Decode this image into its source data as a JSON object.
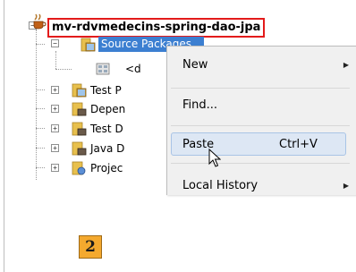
{
  "tree": {
    "project": "mv-rdvmedecins-spring-dao-jpa",
    "source_packages": "Source Packages",
    "default_package": "<d",
    "nodes": [
      "Test P",
      "Depen",
      "Test D",
      "Java D",
      "Projec"
    ]
  },
  "context_menu": {
    "items": [
      {
        "label": "New",
        "submenu": true
      },
      {
        "label": "Find...",
        "submenu": false
      },
      {
        "label": "Paste",
        "shortcut": "Ctrl+V",
        "submenu": false
      },
      {
        "label": "Local History",
        "submenu": true
      }
    ]
  },
  "badge": "2",
  "colors": {
    "highlight_border": "#e31b1b",
    "selection": "#3c7fd1",
    "badge": "#f4a92e"
  },
  "icons": [
    "expand-toggle-icon",
    "maven-project-icon",
    "package-folder-icon",
    "package-icon",
    "library-folder-icon",
    "project-folder-icon",
    "submenu-arrow-icon",
    "mouse-pointer-icon"
  ]
}
